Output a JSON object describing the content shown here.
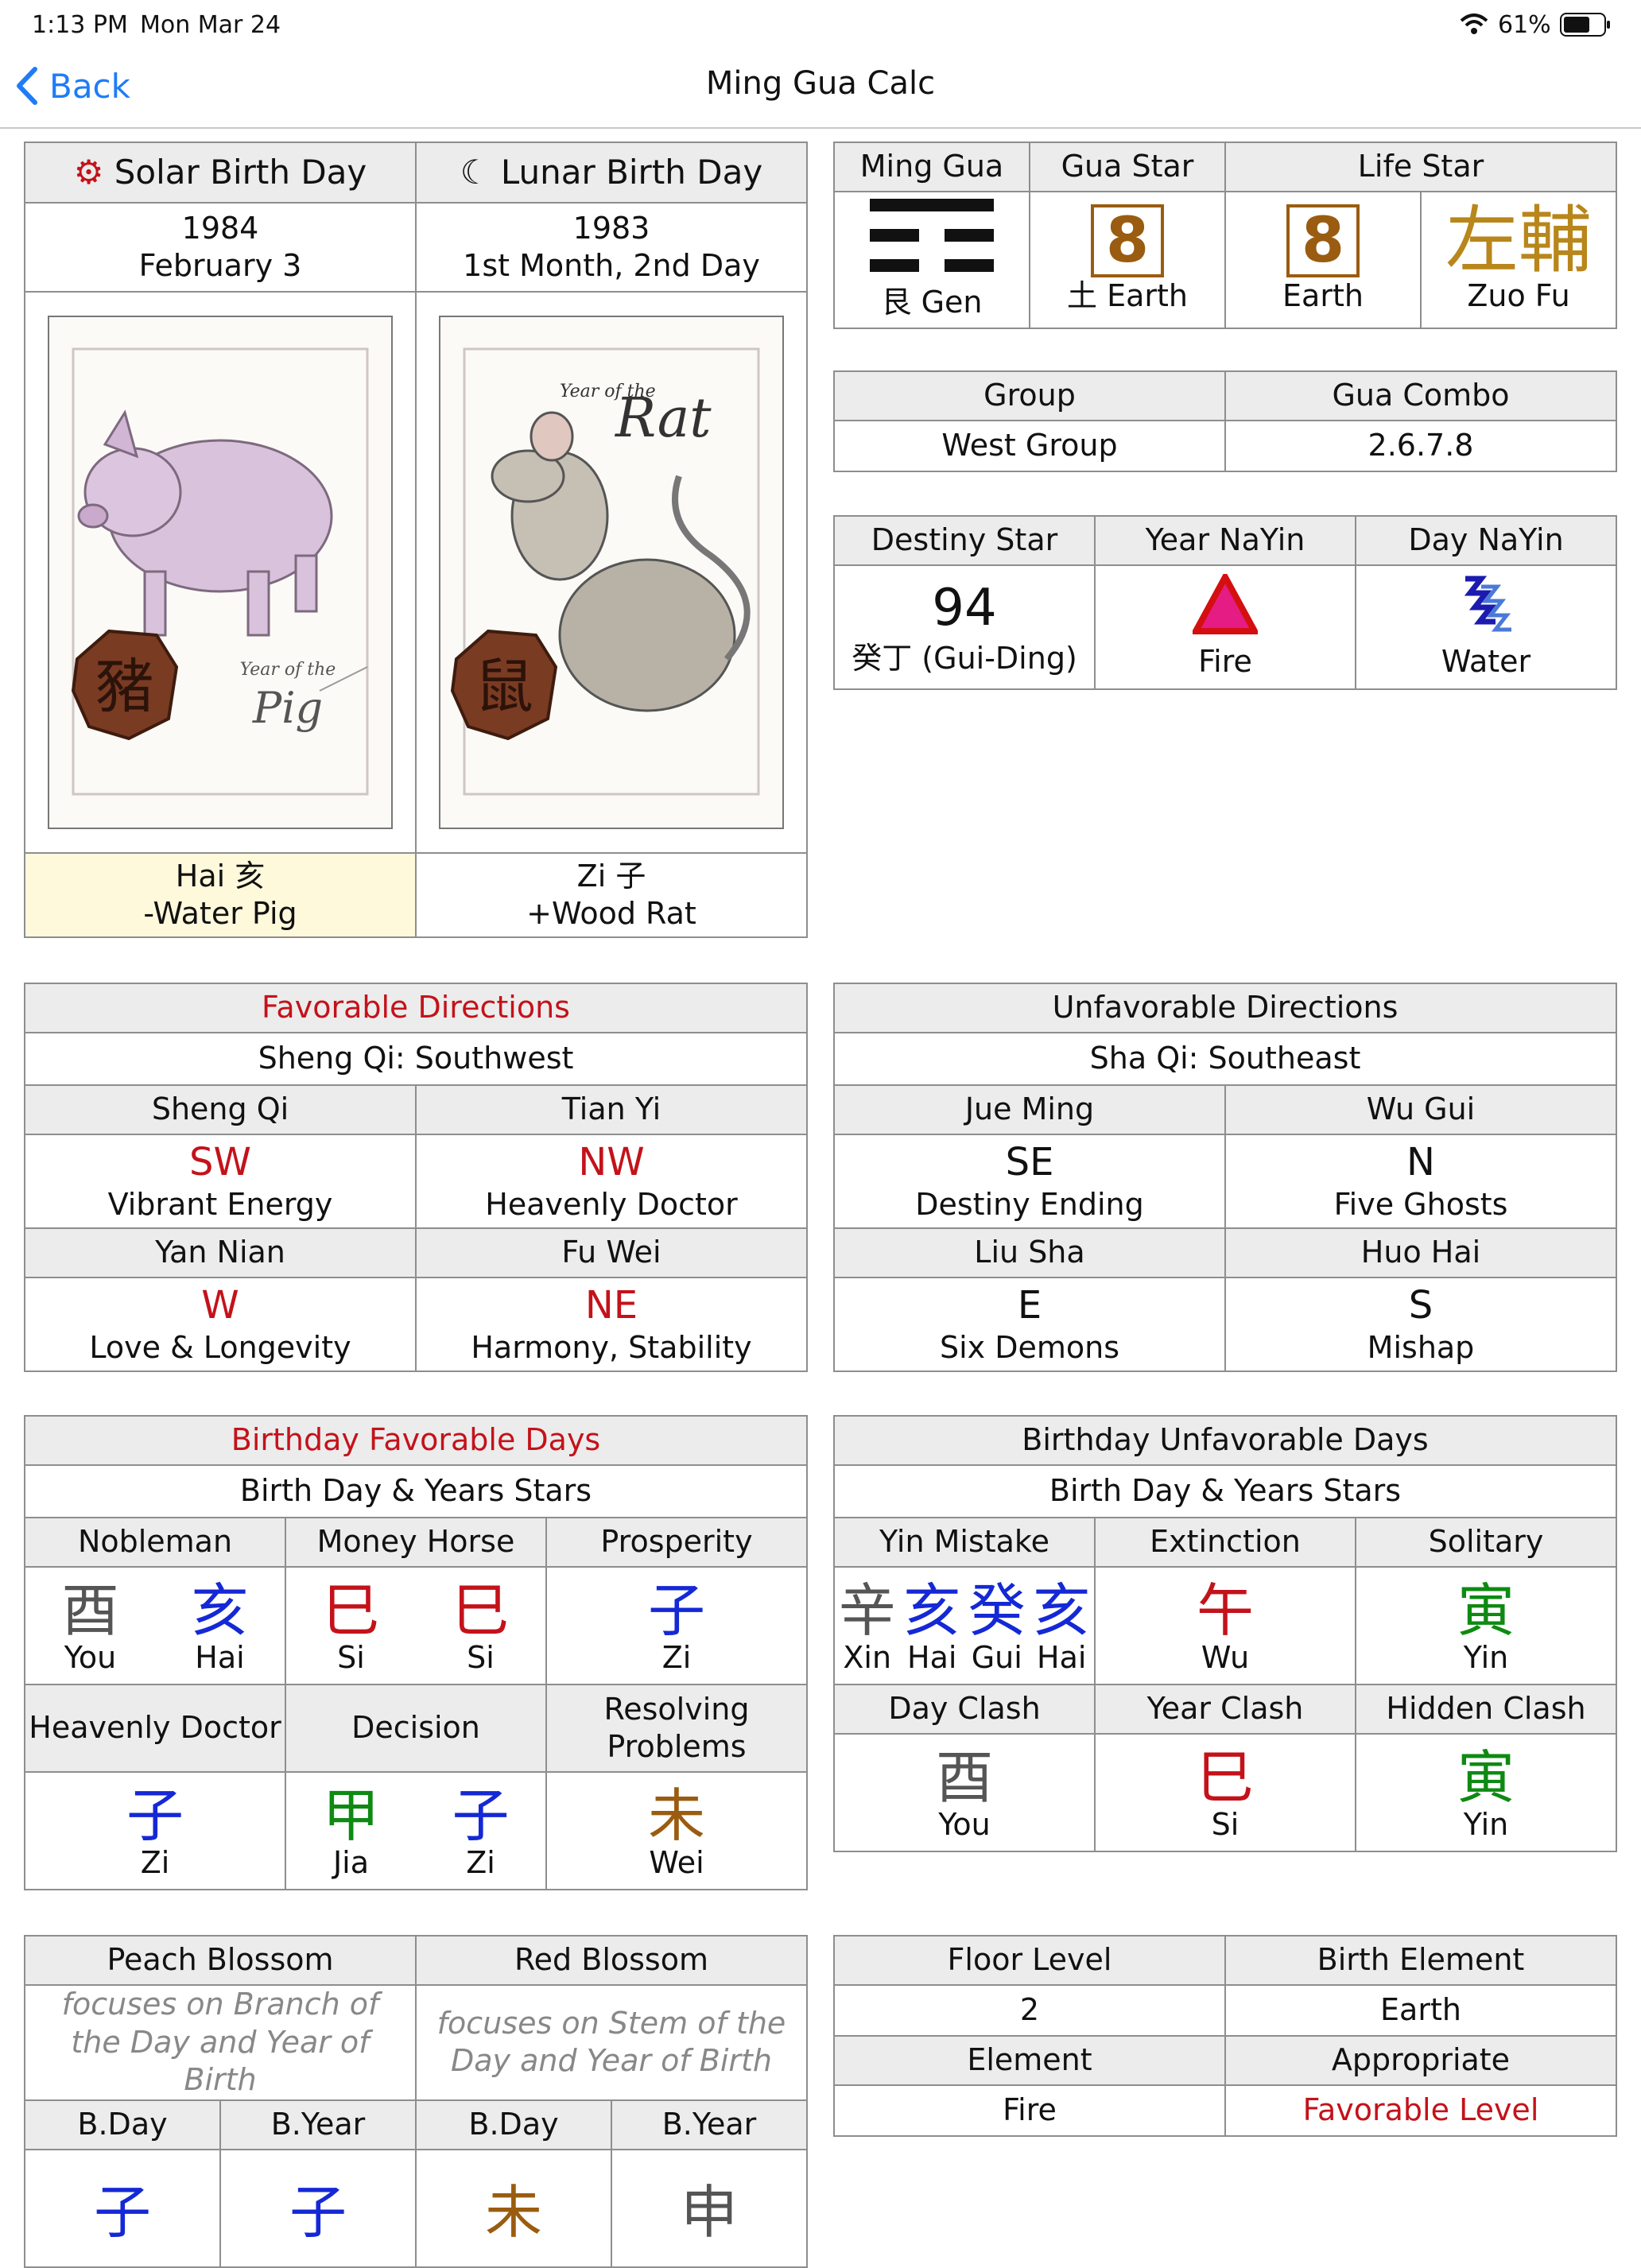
{
  "status": {
    "time": "1:13 PM",
    "date": "Mon Mar 24",
    "battery": "61%"
  },
  "nav": {
    "back": "Back",
    "title": "Ming Gua Calc"
  },
  "birth": {
    "solar_header": "Solar Birth Day",
    "lunar_header": "Lunar Birth Day",
    "solar_year": "1984",
    "solar_date": "February 3",
    "lunar_year": "1983",
    "lunar_date": "1st Month, 2nd Day",
    "pig_year_text": "Year of the",
    "pig_name": "Pig",
    "pig_seal": "豬",
    "rat_year_text": "Year of the",
    "rat_name": "Rat",
    "rat_seal": "鼠",
    "solar_branch": "Hai 亥",
    "solar_animal": "-Water Pig",
    "lunar_branch": "Zi 子",
    "lunar_animal": "+Wood Rat"
  },
  "gua": {
    "h_ming": "Ming Gua",
    "h_star": "Gua Star",
    "h_life": "Life Star",
    "ming_label": "艮 Gen",
    "star_num": "8",
    "star_label": "土 Earth",
    "life_num": "8",
    "life_label": "Earth",
    "life_chars": "左輔",
    "life_name": "Zuo Fu"
  },
  "group": {
    "h_group": "Group",
    "h_combo": "Gua Combo",
    "group": "West Group",
    "combo": "2.6.7.8"
  },
  "destiny": {
    "h_destiny": "Destiny Star",
    "h_year": "Year NaYin",
    "h_day": "Day NaYin",
    "num": "94",
    "stem": "癸丁 (Gui-Ding)",
    "year_el": "Fire",
    "day_el": "Water"
  },
  "fav_dir": {
    "title": "Favorable Directions",
    "sub": "Sheng Qi: Southwest",
    "cells": [
      {
        "h": "Sheng Qi",
        "d": "SW",
        "m": "Vibrant Energy"
      },
      {
        "h": "Tian Yi",
        "d": "NW",
        "m": "Heavenly Doctor"
      },
      {
        "h": "Yan Nian",
        "d": "W",
        "m": "Love & Longevity"
      },
      {
        "h": "Fu Wei",
        "d": "NE",
        "m": "Harmony, Stability"
      }
    ]
  },
  "unfav_dir": {
    "title": "Unfavorable Directions",
    "sub": "Sha Qi: Southeast",
    "cells": [
      {
        "h": "Jue Ming",
        "d": "SE",
        "m": "Destiny Ending"
      },
      {
        "h": "Wu Gui",
        "d": "N",
        "m": "Five Ghosts"
      },
      {
        "h": "Liu Sha",
        "d": "E",
        "m": "Six Demons"
      },
      {
        "h": "Huo Hai",
        "d": "S",
        "m": "Mishap"
      }
    ]
  },
  "fav_days": {
    "title": "Birthday Favorable Days",
    "sub": "Birth Day & Years Stars",
    "h1": "Nobleman",
    "h2": "Money Horse",
    "h3": "Prosperity",
    "r1": [
      {
        "c": "酉",
        "p": "You"
      },
      {
        "c": "亥",
        "p": "Hai"
      },
      {
        "c": "巳",
        "p": "Si"
      },
      {
        "c": "巳",
        "p": "Si"
      },
      {
        "c": "子",
        "p": "Zi"
      }
    ],
    "h4": "Heavenly Doctor",
    "h5": "Decision",
    "h6": "Resolving Problems",
    "r2": [
      {
        "c": "子",
        "p": "Zi"
      },
      {
        "c": "甲",
        "p": "Jia"
      },
      {
        "c": "子",
        "p": "Zi"
      },
      {
        "c": "未",
        "p": "Wei"
      }
    ]
  },
  "unfav_days": {
    "title": "Birthday Unfavorable Days",
    "sub": "Birth Day & Years Stars",
    "h1": "Yin Mistake",
    "h2": "Extinction",
    "h3": "Solitary",
    "yin_chars": [
      "辛",
      "亥",
      "癸",
      "亥"
    ],
    "yin_pin": [
      "Xin",
      "Hai",
      "Gui",
      "Hai"
    ],
    "ext": {
      "c": "午",
      "p": "Wu"
    },
    "sol": {
      "c": "寅",
      "p": "Yin"
    },
    "h4": "Day Clash",
    "h5": "Year Clash",
    "h6": "Hidden Clash",
    "day": {
      "c": "酉",
      "p": "You"
    },
    "year": {
      "c": "巳",
      "p": "Si"
    },
    "hidden": {
      "c": "寅",
      "p": "Yin"
    }
  },
  "blossom": {
    "h_peach": "Peach Blossom",
    "h_red": "Red Blossom",
    "peach_desc": "focuses on Branch of the Day and Year of Birth",
    "red_desc": "focuses on Stem of the Day and Year of Birth",
    "bday": "B.Day",
    "byear": "B.Year",
    "chars": [
      "子",
      "子",
      "未",
      "申"
    ]
  },
  "floor": {
    "h_floor": "Floor Level",
    "h_birth": "Birth Element",
    "floor": "2",
    "birth": "Earth",
    "h_element": "Element",
    "h_appr": "Appropriate",
    "element": "Fire",
    "appr": "Favorable Level"
  },
  "colors": {
    "accent": "#1f7cf6",
    "favorable": "#c4121a",
    "header": "#ececec",
    "highlight": "#fff9dc"
  }
}
